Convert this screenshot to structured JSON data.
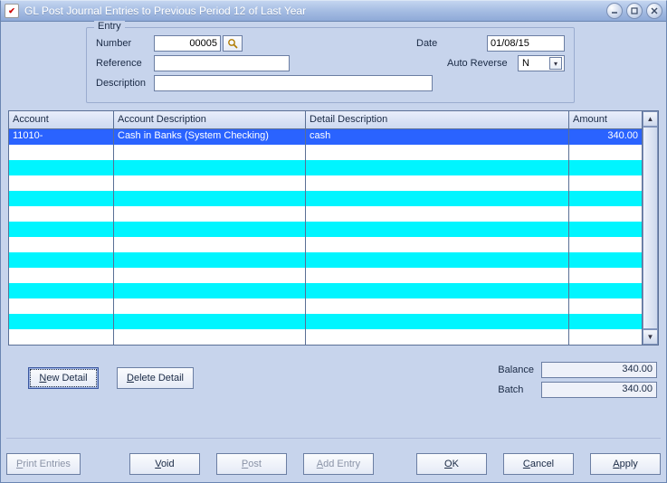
{
  "window": {
    "title": "GL Post Journal Entries to Previous Period 12 of Last Year"
  },
  "entry": {
    "legend": "Entry",
    "labels": {
      "number": "Number",
      "reference": "Reference",
      "description": "Description",
      "date": "Date",
      "auto_reverse": "Auto Reverse"
    },
    "number": "00005",
    "reference": "",
    "description": "",
    "date": "01/08/15",
    "auto_reverse": "N"
  },
  "grid": {
    "headers": {
      "account": "Account",
      "acct_desc": "Account Description",
      "detail_desc": "Detail Description",
      "amount": "Amount"
    },
    "rows": [
      {
        "account": "11010-",
        "acct_desc": "Cash in Banks (System Checking)",
        "detail_desc": "cash",
        "amount": "340.00"
      }
    ]
  },
  "labels": {
    "balance": "Balance",
    "batch": "Batch"
  },
  "totals": {
    "balance": "340.00",
    "batch": "340.00"
  },
  "buttons": {
    "new_detail": "New Detail",
    "delete_detail": "Delete Detail",
    "print_entries": "Print Entries",
    "void": "Void",
    "post": "Post",
    "add_entry": "Add Entry",
    "ok": "OK",
    "cancel": "Cancel",
    "apply": "Apply"
  },
  "mnemonics": {
    "new_detail": "N",
    "delete_detail": "D",
    "print_entries": "P",
    "void": "V",
    "post": "P",
    "add_entry": "A",
    "ok": "O",
    "cancel": "C",
    "apply": "A"
  }
}
